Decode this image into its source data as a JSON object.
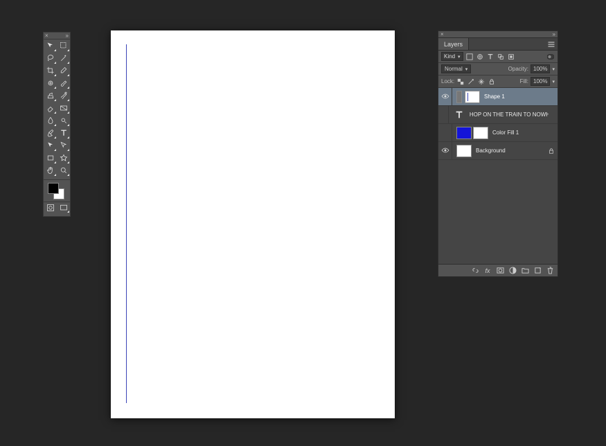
{
  "toolbar": {
    "tools": [
      "move",
      "rect-select",
      "lasso",
      "magic-wand",
      "crop",
      "eyedropper",
      "spot-heal",
      "brush",
      "clone-stamp",
      "history-brush",
      "eraser",
      "gradient",
      "blur",
      "dodge",
      "pen",
      "type",
      "path-select",
      "direct-select",
      "rectangle",
      "custom-shape",
      "hand",
      "zoom"
    ],
    "foreground_color": "#000000",
    "background_color": "#ffffff"
  },
  "layers_panel": {
    "tab_label": "Layers",
    "filter_kind_label": "Kind",
    "blend_mode": "Normal",
    "opacity_label": "Opacity:",
    "opacity_value": "100%",
    "lock_label": "Lock:",
    "fill_label": "Fill:",
    "fill_value": "100%",
    "layers": [
      {
        "name": "Shape 1",
        "type": "shape",
        "visible": true,
        "selected": true,
        "locked": false
      },
      {
        "name": "HOP ON THE TRAIN TO NOWHERE BABY",
        "type": "type",
        "visible": false,
        "selected": false,
        "locked": false
      },
      {
        "name": "Color Fill 1",
        "type": "colorfill",
        "visible": false,
        "selected": false,
        "locked": false
      },
      {
        "name": "Background",
        "type": "background",
        "visible": true,
        "selected": false,
        "locked": true
      }
    ]
  },
  "canvas": {
    "background": "#ffffff",
    "line_color": "#3a44b7"
  }
}
